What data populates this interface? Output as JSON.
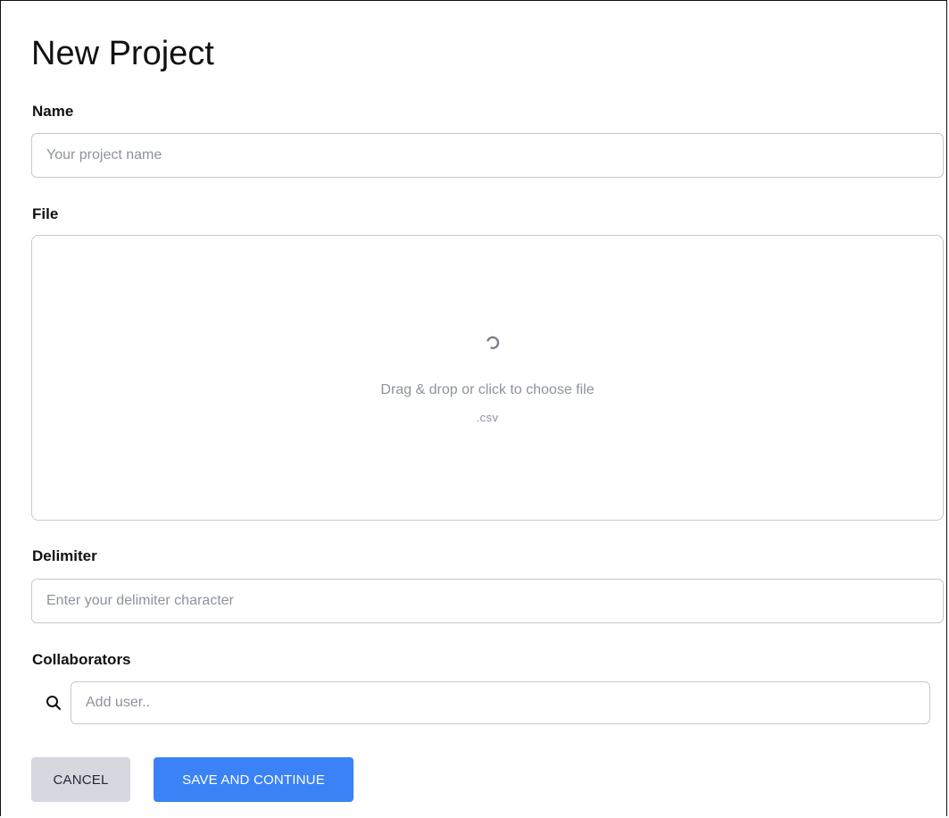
{
  "page": {
    "title": "New Project"
  },
  "form": {
    "name": {
      "label": "Name",
      "placeholder": "Your project name",
      "value": ""
    },
    "file": {
      "label": "File",
      "dropzone_text": "Drag & drop or click to choose file",
      "accepted_ext": ".csv",
      "icon": "loading-spinner-icon"
    },
    "delimiter": {
      "label": "Delimiter",
      "placeholder": "Enter your delimiter character",
      "value": ""
    },
    "collaborators": {
      "label": "Collaborators",
      "placeholder": "Add user..",
      "icon": "search-icon",
      "value": ""
    }
  },
  "actions": {
    "cancel_label": "CANCEL",
    "save_label": "SAVE AND CONTINUE"
  },
  "colors": {
    "primary": "#3b82f6",
    "secondary": "#d5d8de",
    "border": "#c7c9ce",
    "muted_text": "#8d939c"
  }
}
